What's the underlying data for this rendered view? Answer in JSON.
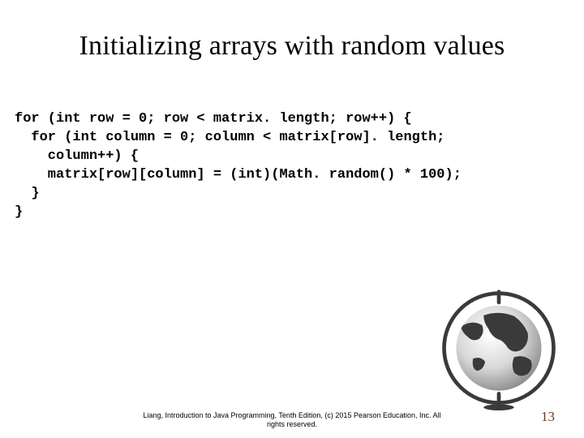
{
  "title": "Initializing arrays with random values",
  "code": {
    "l1": "for (int row = 0; row < matrix. length; row++) {",
    "l2": "  for (int column = 0; column < matrix[row]. length;",
    "l3": "    column++) {",
    "l4": "    matrix[row][column] = (int)(Math. random() * 100);",
    "l5": "  }",
    "l6": "}"
  },
  "footer": {
    "line1": "Liang, Introduction to Java Programming, Tenth Edition, (c) 2015 Pearson Education, Inc. All",
    "line2": "rights reserved."
  },
  "page_number": "13"
}
